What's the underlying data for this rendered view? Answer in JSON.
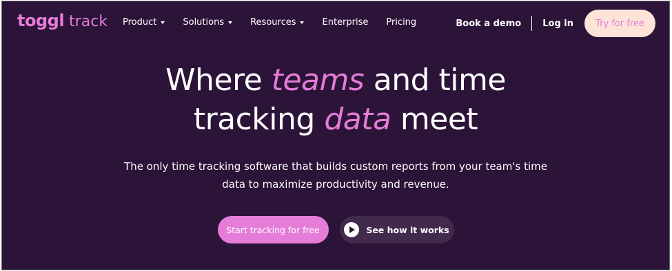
{
  "brand": {
    "logo_mark": "toggl",
    "logo_word": "track",
    "accent_color": "#e57cd8",
    "background_color": "#2c1338"
  },
  "nav": {
    "items": [
      {
        "label": "Product",
        "has_dropdown": true
      },
      {
        "label": "Solutions",
        "has_dropdown": true
      },
      {
        "label": "Resources",
        "has_dropdown": true
      },
      {
        "label": "Enterprise",
        "has_dropdown": false
      },
      {
        "label": "Pricing",
        "has_dropdown": false
      }
    ],
    "book_demo": "Book a demo",
    "login": "Log in",
    "try_free": "Try for free"
  },
  "hero": {
    "line1_pre": "Where ",
    "line1_accent": "teams",
    "line1_post": " and time",
    "line2_pre": "tracking ",
    "line2_accent": "data",
    "line2_post": " meet",
    "sub_line1": "The only time tracking software that builds custom reports from your team's time",
    "sub_line2": "data to maximize productivity and revenue.",
    "cta_primary": "Start tracking for free",
    "cta_secondary": "See how it works",
    "cta_secondary_icon": "play-icon"
  }
}
